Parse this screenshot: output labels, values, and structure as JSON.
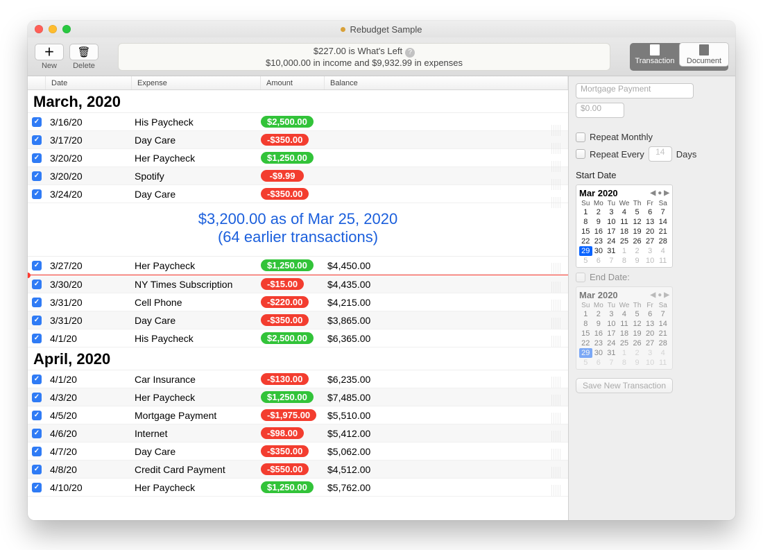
{
  "window_title": "Rebudget Sample",
  "toolbar": {
    "new_label": "New",
    "delete_label": "Delete",
    "seg_transaction": "Transaction",
    "seg_document": "Document"
  },
  "summary": {
    "line1": "$227.00 is What's Left",
    "line2": "$10,000.00 in income and $9,932.99 in expenses"
  },
  "columns": {
    "date": "Date",
    "expense": "Expense",
    "amount": "Amount",
    "balance": "Balance"
  },
  "month1": "March, 2020",
  "rows1": [
    {
      "date": "3/16/20",
      "expense": "His Paycheck",
      "amount": "$2,500.00",
      "type": "green",
      "balance": ""
    },
    {
      "date": "3/17/20",
      "expense": "Day Care",
      "amount": "-$350.00",
      "type": "red",
      "balance": ""
    },
    {
      "date": "3/20/20",
      "expense": "Her Paycheck",
      "amount": "$1,250.00",
      "type": "green",
      "balance": ""
    },
    {
      "date": "3/20/20",
      "expense": "Spotify",
      "amount": "-$9.99",
      "type": "red",
      "balance": ""
    },
    {
      "date": "3/24/20",
      "expense": "Day Care",
      "amount": "-$350.00",
      "type": "red",
      "balance": ""
    }
  ],
  "mid_summary": {
    "line1": "$3,200.00 as of Mar 25, 2020",
    "line2": "(64 earlier transactions)"
  },
  "rows2": [
    {
      "date": "3/27/20",
      "expense": "Her Paycheck",
      "amount": "$1,250.00",
      "type": "green",
      "balance": "$4,450.00"
    }
  ],
  "rows3": [
    {
      "date": "3/30/20",
      "expense": "NY Times Subscription",
      "amount": "-$15.00",
      "type": "red",
      "balance": "$4,435.00"
    },
    {
      "date": "3/31/20",
      "expense": "Cell Phone",
      "amount": "-$220.00",
      "type": "red",
      "balance": "$4,215.00"
    },
    {
      "date": "3/31/20",
      "expense": "Day Care",
      "amount": "-$350.00",
      "type": "red",
      "balance": "$3,865.00"
    },
    {
      "date": "4/1/20",
      "expense": "His Paycheck",
      "amount": "$2,500.00",
      "type": "green",
      "balance": "$6,365.00"
    }
  ],
  "month2": "April, 2020",
  "rows4": [
    {
      "date": "4/1/20",
      "expense": "Car Insurance",
      "amount": "-$130.00",
      "type": "red",
      "balance": "$6,235.00"
    },
    {
      "date": "4/3/20",
      "expense": "Her Paycheck",
      "amount": "$1,250.00",
      "type": "green",
      "balance": "$7,485.00"
    },
    {
      "date": "4/5/20",
      "expense": "Mortgage Payment",
      "amount": "-$1,975.00",
      "type": "red",
      "balance": "$5,510.00"
    },
    {
      "date": "4/6/20",
      "expense": "Internet",
      "amount": "-$98.00",
      "type": "red",
      "balance": "$5,412.00"
    },
    {
      "date": "4/7/20",
      "expense": "Day Care",
      "amount": "-$350.00",
      "type": "red",
      "balance": "$5,062.00"
    },
    {
      "date": "4/8/20",
      "expense": "Credit Card Payment",
      "amount": "-$550.00",
      "type": "red",
      "balance": "$4,512.00"
    },
    {
      "date": "4/10/20",
      "expense": "Her Paycheck",
      "amount": "$1,250.00",
      "type": "green",
      "balance": "$5,762.00"
    }
  ],
  "sidebar": {
    "name_placeholder": "Mortgage Payment",
    "amount_placeholder": "$0.00",
    "repeat_monthly": "Repeat Monthly",
    "repeat_every": "Repeat Every",
    "repeat_every_value": "14",
    "repeat_days": "Days",
    "start_date_label": "Start Date",
    "end_date_label": "End Date:",
    "cal_title": "Mar 2020",
    "save_label": "Save New Transaction",
    "dow": [
      "Su",
      "Mo",
      "Tu",
      "We",
      "Th",
      "Fr",
      "Sa"
    ],
    "days": [
      {
        "d": "1"
      },
      {
        "d": "2"
      },
      {
        "d": "3"
      },
      {
        "d": "4"
      },
      {
        "d": "5"
      },
      {
        "d": "6"
      },
      {
        "d": "7"
      },
      {
        "d": "8"
      },
      {
        "d": "9"
      },
      {
        "d": "10"
      },
      {
        "d": "11"
      },
      {
        "d": "12"
      },
      {
        "d": "13"
      },
      {
        "d": "14"
      },
      {
        "d": "15"
      },
      {
        "d": "16"
      },
      {
        "d": "17"
      },
      {
        "d": "18"
      },
      {
        "d": "19"
      },
      {
        "d": "20"
      },
      {
        "d": "21"
      },
      {
        "d": "22"
      },
      {
        "d": "23"
      },
      {
        "d": "24"
      },
      {
        "d": "25"
      },
      {
        "d": "26"
      },
      {
        "d": "27"
      },
      {
        "d": "28"
      },
      {
        "d": "29",
        "sel": true
      },
      {
        "d": "30"
      },
      {
        "d": "31"
      },
      {
        "d": "1",
        "o": true
      },
      {
        "d": "2",
        "o": true
      },
      {
        "d": "3",
        "o": true
      },
      {
        "d": "4",
        "o": true
      },
      {
        "d": "5",
        "o": true
      },
      {
        "d": "6",
        "o": true
      },
      {
        "d": "7",
        "o": true
      },
      {
        "d": "8",
        "o": true
      },
      {
        "d": "9",
        "o": true
      },
      {
        "d": "10",
        "o": true
      },
      {
        "d": "11",
        "o": true
      }
    ]
  }
}
